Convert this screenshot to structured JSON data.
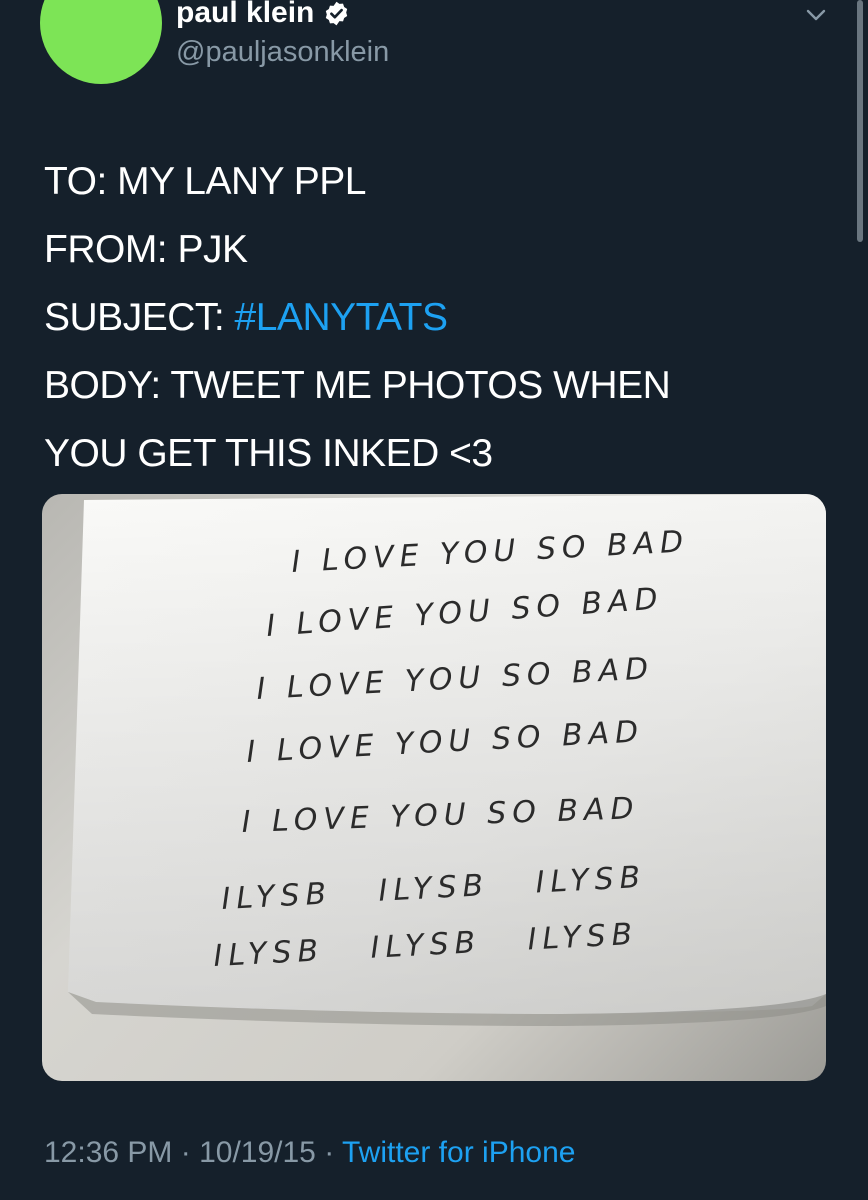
{
  "tweet": {
    "author": {
      "name": "paul klein",
      "handle": "@pauljasonklein",
      "verified": true,
      "avatar_color": "#7de456"
    },
    "text_lines": [
      {
        "prefix": "TO: MY LANY PPL",
        "hashtag": ""
      },
      {
        "prefix": "FROM: PJK",
        "hashtag": ""
      },
      {
        "prefix": "SUBJECT: ",
        "hashtag": "#LANYTATS"
      },
      {
        "prefix": "BODY: TWEET ME PHOTOS WHEN",
        "hashtag": ""
      },
      {
        "prefix": "YOU GET THIS INKED <3",
        "hashtag": ""
      }
    ],
    "image": {
      "handwriting_lines": [
        "I LOVE YOU SO BAD",
        "I LOVE YOU SO BAD",
        "I LOVE YOU SO BAD",
        "I LOVE YOU SO BAD",
        "I LOVE YOU SO BAD",
        "ILYSB   ILYSB   ILYSB",
        "ILYSB   ILYSB   ILYSB"
      ]
    },
    "time": "12:36 PM",
    "separator": " · ",
    "date": "10/19/15",
    "source": "Twitter for iPhone"
  },
  "colors": {
    "background": "#15202b",
    "text": "#ffffff",
    "secondary": "#8899a6",
    "link": "#1da1f2"
  },
  "icons": {
    "verified": "verified-badge-icon",
    "more": "chevron-down-icon"
  }
}
